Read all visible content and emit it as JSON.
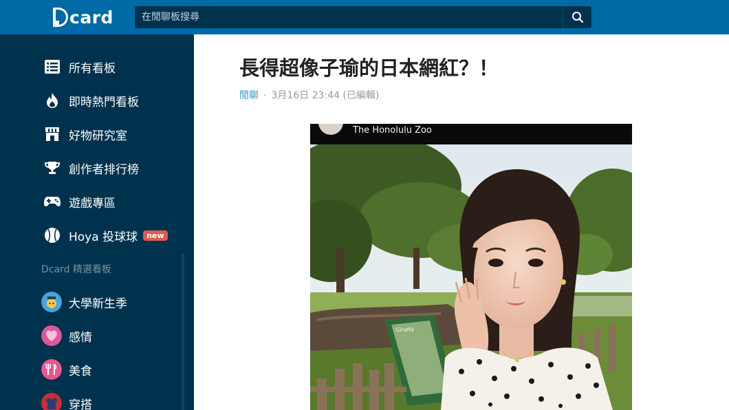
{
  "header": {
    "logo_text": "card",
    "search_placeholder": "在閒聊板搜尋"
  },
  "sidebar": {
    "items": [
      {
        "label": "所有看板",
        "icon": "board-list-icon"
      },
      {
        "label": "即時熱門看板",
        "icon": "flame-icon"
      },
      {
        "label": "好物研究室",
        "icon": "shop-icon"
      },
      {
        "label": "創作者排行榜",
        "icon": "trophy-icon"
      },
      {
        "label": "遊戲專區",
        "icon": "gamepad-icon"
      },
      {
        "label": "Hoya 投球球",
        "icon": "baseball-icon",
        "badge": "new"
      }
    ],
    "section_title": "Dcard 精選看板",
    "forums": [
      {
        "label": "大學新生季",
        "icon": "freshman-forum-icon",
        "color": "#4aa3df"
      },
      {
        "label": "感情",
        "icon": "relationship-forum-icon",
        "color": "#e0569b"
      },
      {
        "label": "美食",
        "icon": "food-forum-icon",
        "color": "#e8578d"
      },
      {
        "label": "穿搭",
        "icon": "dressup-forum-icon",
        "color": "#c62f3c"
      }
    ]
  },
  "post": {
    "title": "長得超像子瑜的日本網紅？！",
    "board": "閒聊",
    "separator": "·",
    "date": "3月16日 23:44 (已編輯)",
    "image_caption": "The Honolulu Zoo",
    "sign_text": "Giraffe"
  },
  "colors": {
    "header": "#006aa6",
    "sidebar": "#00324e",
    "accent": "#3397cf",
    "badge": "#e05a50"
  }
}
